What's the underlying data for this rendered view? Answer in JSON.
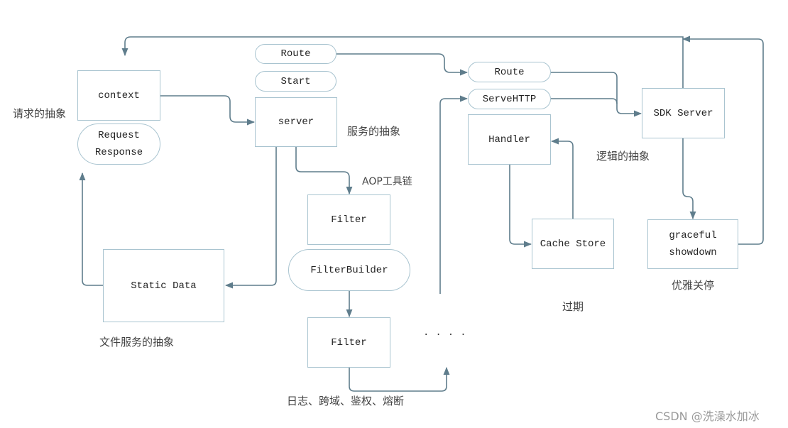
{
  "diagram": {
    "nodes": {
      "context": "context",
      "request": "Request",
      "response": "Response",
      "route_top": "Route",
      "start": "Start",
      "server": "server",
      "filter_1": "Filter",
      "filter_builder": "FilterBuilder",
      "filter_2": "Filter",
      "static_data": "Static Data",
      "route_right": "Route",
      "serve_http": "ServeHTTP",
      "handler": "Handler",
      "cache_store": "Cache Store",
      "sdk_server": "SDK Server",
      "graceful": "graceful",
      "showdown": "showdown"
    },
    "labels": {
      "request_abstraction": "请求的抽象",
      "service_abstraction": "服务的抽象",
      "aop_toolchain": "AOP工具链",
      "file_service_abstraction": "文件服务的抽象",
      "filter_examples": "日志、跨域、鉴权、熔断",
      "logic_abstraction": "逻辑的抽象",
      "expiry": "过期",
      "graceful_shutdown": "优雅关停",
      "ellipsis": "····"
    },
    "edges": [
      {
        "from": "context",
        "to": "server"
      },
      {
        "from": "route_top",
        "to": "route_right"
      },
      {
        "from": "route_right",
        "to": "sdk_server"
      },
      {
        "from": "serve_http",
        "to": "sdk_server"
      },
      {
        "from": "server",
        "to": "filter_1"
      },
      {
        "from": "server",
        "to": "static_data"
      },
      {
        "from": "static_data",
        "to": "request_response"
      },
      {
        "from": "filter_builder",
        "to": "filter_2"
      },
      {
        "from": "filter_2",
        "to": "ellipsis"
      },
      {
        "from": "ellipsis",
        "to": "serve_http"
      },
      {
        "from": "handler",
        "to": "cache_store"
      },
      {
        "from": "cache_store",
        "to": "handler"
      },
      {
        "from": "sdk_server",
        "to": "graceful_showdown"
      },
      {
        "from": "sdk_server",
        "to": "context"
      },
      {
        "from": "graceful_showdown",
        "to": "top_loop"
      }
    ],
    "colors": {
      "edge": "#5f7d8c",
      "node_border": "#a9c4d0",
      "text": "#222222",
      "label": "#444444"
    }
  },
  "watermark": "CSDN @洗澡水加冰"
}
